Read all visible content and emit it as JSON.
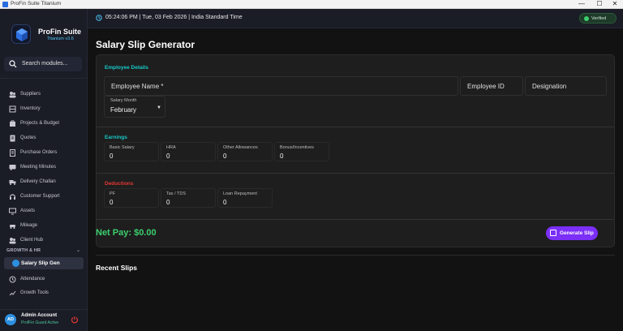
{
  "window": {
    "title": "ProFin Suite Titanium",
    "controls": [
      "—",
      "☐",
      "✕"
    ]
  },
  "brand": {
    "name": "ProFin Suite",
    "version": "Titanium v3.6"
  },
  "search": {
    "placeholder": "Search modules..."
  },
  "sidebar": {
    "items": [
      {
        "label": "Suppliers",
        "icon": "suppliers-icon"
      },
      {
        "label": "Inventory",
        "icon": "inventory-icon"
      },
      {
        "label": "Projects & Budget",
        "icon": "projects-icon"
      },
      {
        "label": "Quotes",
        "icon": "quotes-icon"
      },
      {
        "label": "Purchase Orders",
        "icon": "purchase-orders-icon"
      },
      {
        "label": "Meeting Minutes",
        "icon": "meeting-icon"
      },
      {
        "label": "Delivery Challan",
        "icon": "delivery-icon"
      },
      {
        "label": "Customer Support",
        "icon": "support-icon"
      },
      {
        "label": "Assets",
        "icon": "assets-icon"
      },
      {
        "label": "Mileage",
        "icon": "mileage-icon"
      },
      {
        "label": "Client Hub",
        "icon": "client-hub-icon"
      }
    ],
    "section": "GROWTH & HR",
    "active": "Salary Slip Gen",
    "after_active": [
      "Attendance",
      "Growth Tools"
    ]
  },
  "user": {
    "initials": "AD",
    "name": "Admin Account",
    "role": "ProfFin Guard Active"
  },
  "topbar": {
    "datetime": "05:24:06 PM | Tue, 03 Feb 2026 | India Standard Time",
    "status": "Verified"
  },
  "page": {
    "title": "Salary Slip Generator"
  },
  "employee": {
    "section_title": "Employee Details",
    "name_label": "Employee Name *",
    "id_label": "Employee ID",
    "designation_label": "Designation",
    "month_label": "Salary Month",
    "month_value": "February"
  },
  "earnings": {
    "section_title": "Earnings",
    "fields": [
      {
        "label": "Basic Salary",
        "value": "0"
      },
      {
        "label": "HRA",
        "value": "0"
      },
      {
        "label": "Other Allowances",
        "value": "0"
      },
      {
        "label": "Bonus/Incentives",
        "value": "0"
      }
    ]
  },
  "deductions": {
    "section_title": "Deductions",
    "fields": [
      {
        "label": "PF",
        "value": "0"
      },
      {
        "label": "Tax / TDS",
        "value": "0"
      },
      {
        "label": "Loan Repayment",
        "value": "0"
      }
    ]
  },
  "summary": {
    "net_pay": "Net Pay: $0.00",
    "generate_label": "Generate Slip"
  },
  "recent": {
    "title": "Recent Slips"
  },
  "colors": {
    "accent_green": "#3ccf6e",
    "accent_cyan": "#18c8c8",
    "accent_red": "#e53935",
    "button_purple": "#7b2ff7"
  }
}
